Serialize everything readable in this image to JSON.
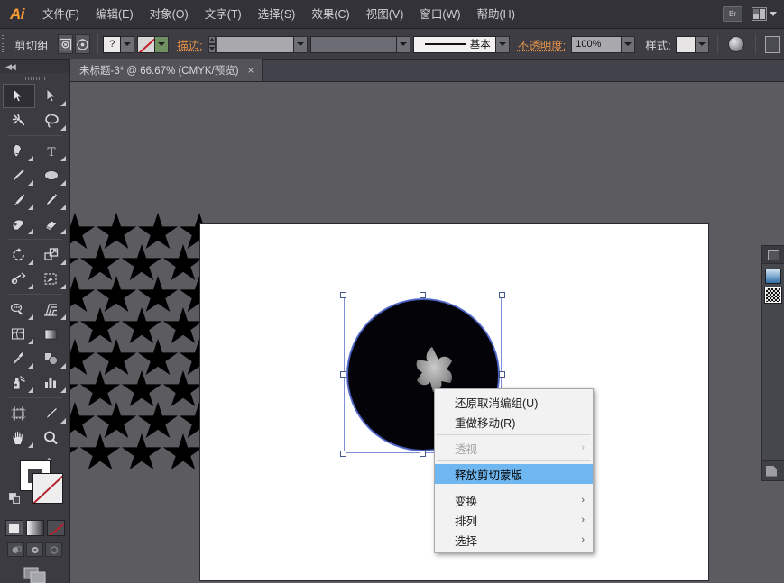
{
  "app": {
    "name": "Ai",
    "title": "Adobe Illustrator"
  },
  "menubar": {
    "items": [
      {
        "label": "文件(F)",
        "name": "menu-file"
      },
      {
        "label": "编辑(E)",
        "name": "menu-edit"
      },
      {
        "label": "对象(O)",
        "name": "menu-object"
      },
      {
        "label": "文字(T)",
        "name": "menu-type"
      },
      {
        "label": "选择(S)",
        "name": "menu-select"
      },
      {
        "label": "效果(C)",
        "name": "menu-effect"
      },
      {
        "label": "视图(V)",
        "name": "menu-view"
      },
      {
        "label": "窗口(W)",
        "name": "menu-window"
      },
      {
        "label": "帮助(H)",
        "name": "menu-help"
      }
    ],
    "bridge_label": "Br",
    "workspace_label": ""
  },
  "optionsbar": {
    "selection_label": "剪切组",
    "stroke_label": "描边:",
    "stroke_weight": "",
    "stroke_variable": "",
    "stroke_profile": "基本",
    "opacity_label": "不透明度:",
    "opacity_value": "100%",
    "style_label": "样式:",
    "question_mark": "?"
  },
  "tabs": [
    {
      "label": "未标题-3* @ 66.67% (CMYK/预览)",
      "close": "×",
      "active": true
    }
  ],
  "toolbar": {
    "tools": [
      {
        "name": "selection-tool",
        "label": "选择工具",
        "selected": true
      },
      {
        "name": "direct-selection-tool",
        "label": "直接选择工具",
        "selected": false
      },
      {
        "name": "magic-wand-tool",
        "label": "魔棒工具",
        "selected": false
      },
      {
        "name": "lasso-tool",
        "label": "套索工具",
        "selected": false
      },
      {
        "name": "pen-tool",
        "label": "钢笔工具",
        "selected": false
      },
      {
        "name": "type-tool",
        "label": "文字工具",
        "selected": false
      },
      {
        "name": "line-segment-tool",
        "label": "直线段工具",
        "selected": false
      },
      {
        "name": "ellipse-tool",
        "label": "椭圆工具",
        "selected": false
      },
      {
        "name": "paintbrush-tool",
        "label": "画笔工具",
        "selected": false
      },
      {
        "name": "pencil-tool",
        "label": "铅笔工具",
        "selected": false
      },
      {
        "name": "blob-brush-tool",
        "label": "斑点画笔工具",
        "selected": false
      },
      {
        "name": "eraser-tool",
        "label": "橡皮擦工具",
        "selected": false
      },
      {
        "name": "rotate-tool",
        "label": "旋转工具",
        "selected": false
      },
      {
        "name": "scale-tool",
        "label": "比例缩放工具",
        "selected": false
      },
      {
        "name": "width-tool",
        "label": "宽度工具",
        "selected": false
      },
      {
        "name": "free-transform-tool",
        "label": "自由变换工具",
        "selected": false
      },
      {
        "name": "shape-builder-tool",
        "label": "形状生成器工具",
        "selected": false
      },
      {
        "name": "perspective-grid-tool",
        "label": "透视网格工具",
        "selected": false
      },
      {
        "name": "mesh-tool",
        "label": "网格工具",
        "selected": false
      },
      {
        "name": "gradient-tool",
        "label": "渐变工具",
        "selected": false
      },
      {
        "name": "eyedropper-tool",
        "label": "吸管工具",
        "selected": false
      },
      {
        "name": "blend-tool",
        "label": "混合工具",
        "selected": false
      },
      {
        "name": "symbol-sprayer-tool",
        "label": "符号喷枪工具",
        "selected": false
      },
      {
        "name": "column-graph-tool",
        "label": "柱形图工具",
        "selected": false
      },
      {
        "name": "artboard-tool",
        "label": "画板工具",
        "selected": false
      },
      {
        "name": "slice-tool",
        "label": "切片工具",
        "selected": false
      },
      {
        "name": "hand-tool",
        "label": "抓手工具",
        "selected": false
      },
      {
        "name": "zoom-tool",
        "label": "缩放工具",
        "selected": false
      }
    ],
    "fill_stroke": {
      "fill_label": "填色",
      "stroke_label": "描边",
      "stroke_is_none": true
    },
    "modes": [
      {
        "name": "color-mode-button",
        "label": "颜色"
      },
      {
        "name": "gradient-mode-button",
        "label": "渐变"
      },
      {
        "name": "none-mode-button",
        "label": "无"
      }
    ],
    "draw_modes": [
      {
        "name": "draw-normal-button",
        "label": "正常绘图"
      },
      {
        "name": "draw-behind-button",
        "label": "背面绘图"
      },
      {
        "name": "draw-inside-button",
        "label": "内部绘图"
      }
    ],
    "screen_mode": {
      "name": "screen-mode-button",
      "label": "更改屏幕模式"
    }
  },
  "canvas": {
    "artboard_bg": "#ffffff",
    "background": "#5b5b60",
    "star_pattern": {
      "rows": 8,
      "cols": 4,
      "color": "#000000"
    },
    "artwork": {
      "shape": "circle",
      "color": "#040408",
      "selected": true,
      "selection_color": "#4a63c8"
    }
  },
  "context_menu": {
    "items": [
      {
        "label": "还原取消编组(U)",
        "name": "ctx-undo-ungroup",
        "disabled": false,
        "submenu": false,
        "active": false
      },
      {
        "label": "重做移动(R)",
        "name": "ctx-redo-move",
        "disabled": false,
        "submenu": false,
        "active": false
      },
      {
        "separator": true
      },
      {
        "label": "透视",
        "name": "ctx-perspective",
        "disabled": true,
        "submenu": true,
        "active": false
      },
      {
        "separator": true
      },
      {
        "label": "释放剪切蒙版",
        "name": "ctx-release-clipping-mask",
        "disabled": false,
        "submenu": false,
        "active": true
      },
      {
        "separator": true
      },
      {
        "label": "变换",
        "name": "ctx-transform",
        "disabled": false,
        "submenu": true,
        "active": false
      },
      {
        "label": "排列",
        "name": "ctx-arrange",
        "disabled": false,
        "submenu": true,
        "active": false
      },
      {
        "label": "选择",
        "name": "ctx-select",
        "disabled": false,
        "submenu": true,
        "active": false
      }
    ],
    "submenu_glyph": "›",
    "highlight_color": "#6fb7f0"
  },
  "right_dock": {
    "panel_label": "",
    "footer_label": ""
  }
}
